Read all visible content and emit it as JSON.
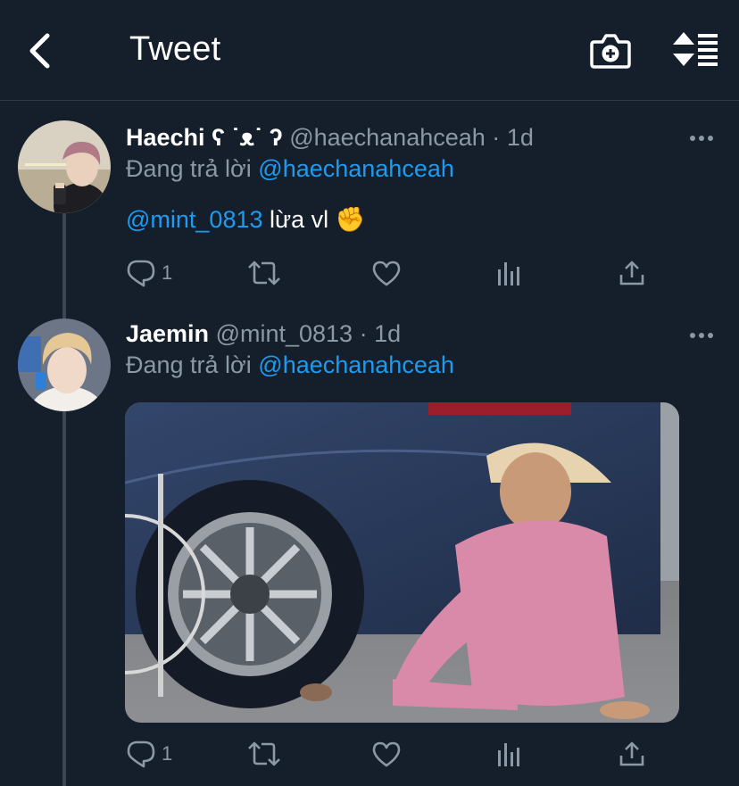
{
  "header": {
    "title": "Tweet",
    "back_icon": "chevron-left-icon",
    "camera_icon": "camera-plus-icon",
    "sort_icon": "sort-list-icon"
  },
  "colors": {
    "background": "#151f2b",
    "accent": "#1d9bf0",
    "secondary_text": "#8b98a5",
    "divider": "#2f3b49"
  },
  "tweets": [
    {
      "name": "Haechi ʕ ˙ᴥ˙ ʔ",
      "handle": "@haechanahceah",
      "separator": "·",
      "time": "1d",
      "reply_prefix": "Đang trả lời",
      "reply_to": "@haechanahceah",
      "mention": "@mint_0813",
      "text": " lừa vl ",
      "emoji": "✊",
      "reply_count": "1"
    },
    {
      "name": "Jaemin",
      "handle": "@mint_0813",
      "separator": "·",
      "time": "1d",
      "reply_prefix": "Đang trả lời",
      "reply_to": "@haechanahceah",
      "media_icon": "photo-icon",
      "reply_count": "1"
    }
  ]
}
